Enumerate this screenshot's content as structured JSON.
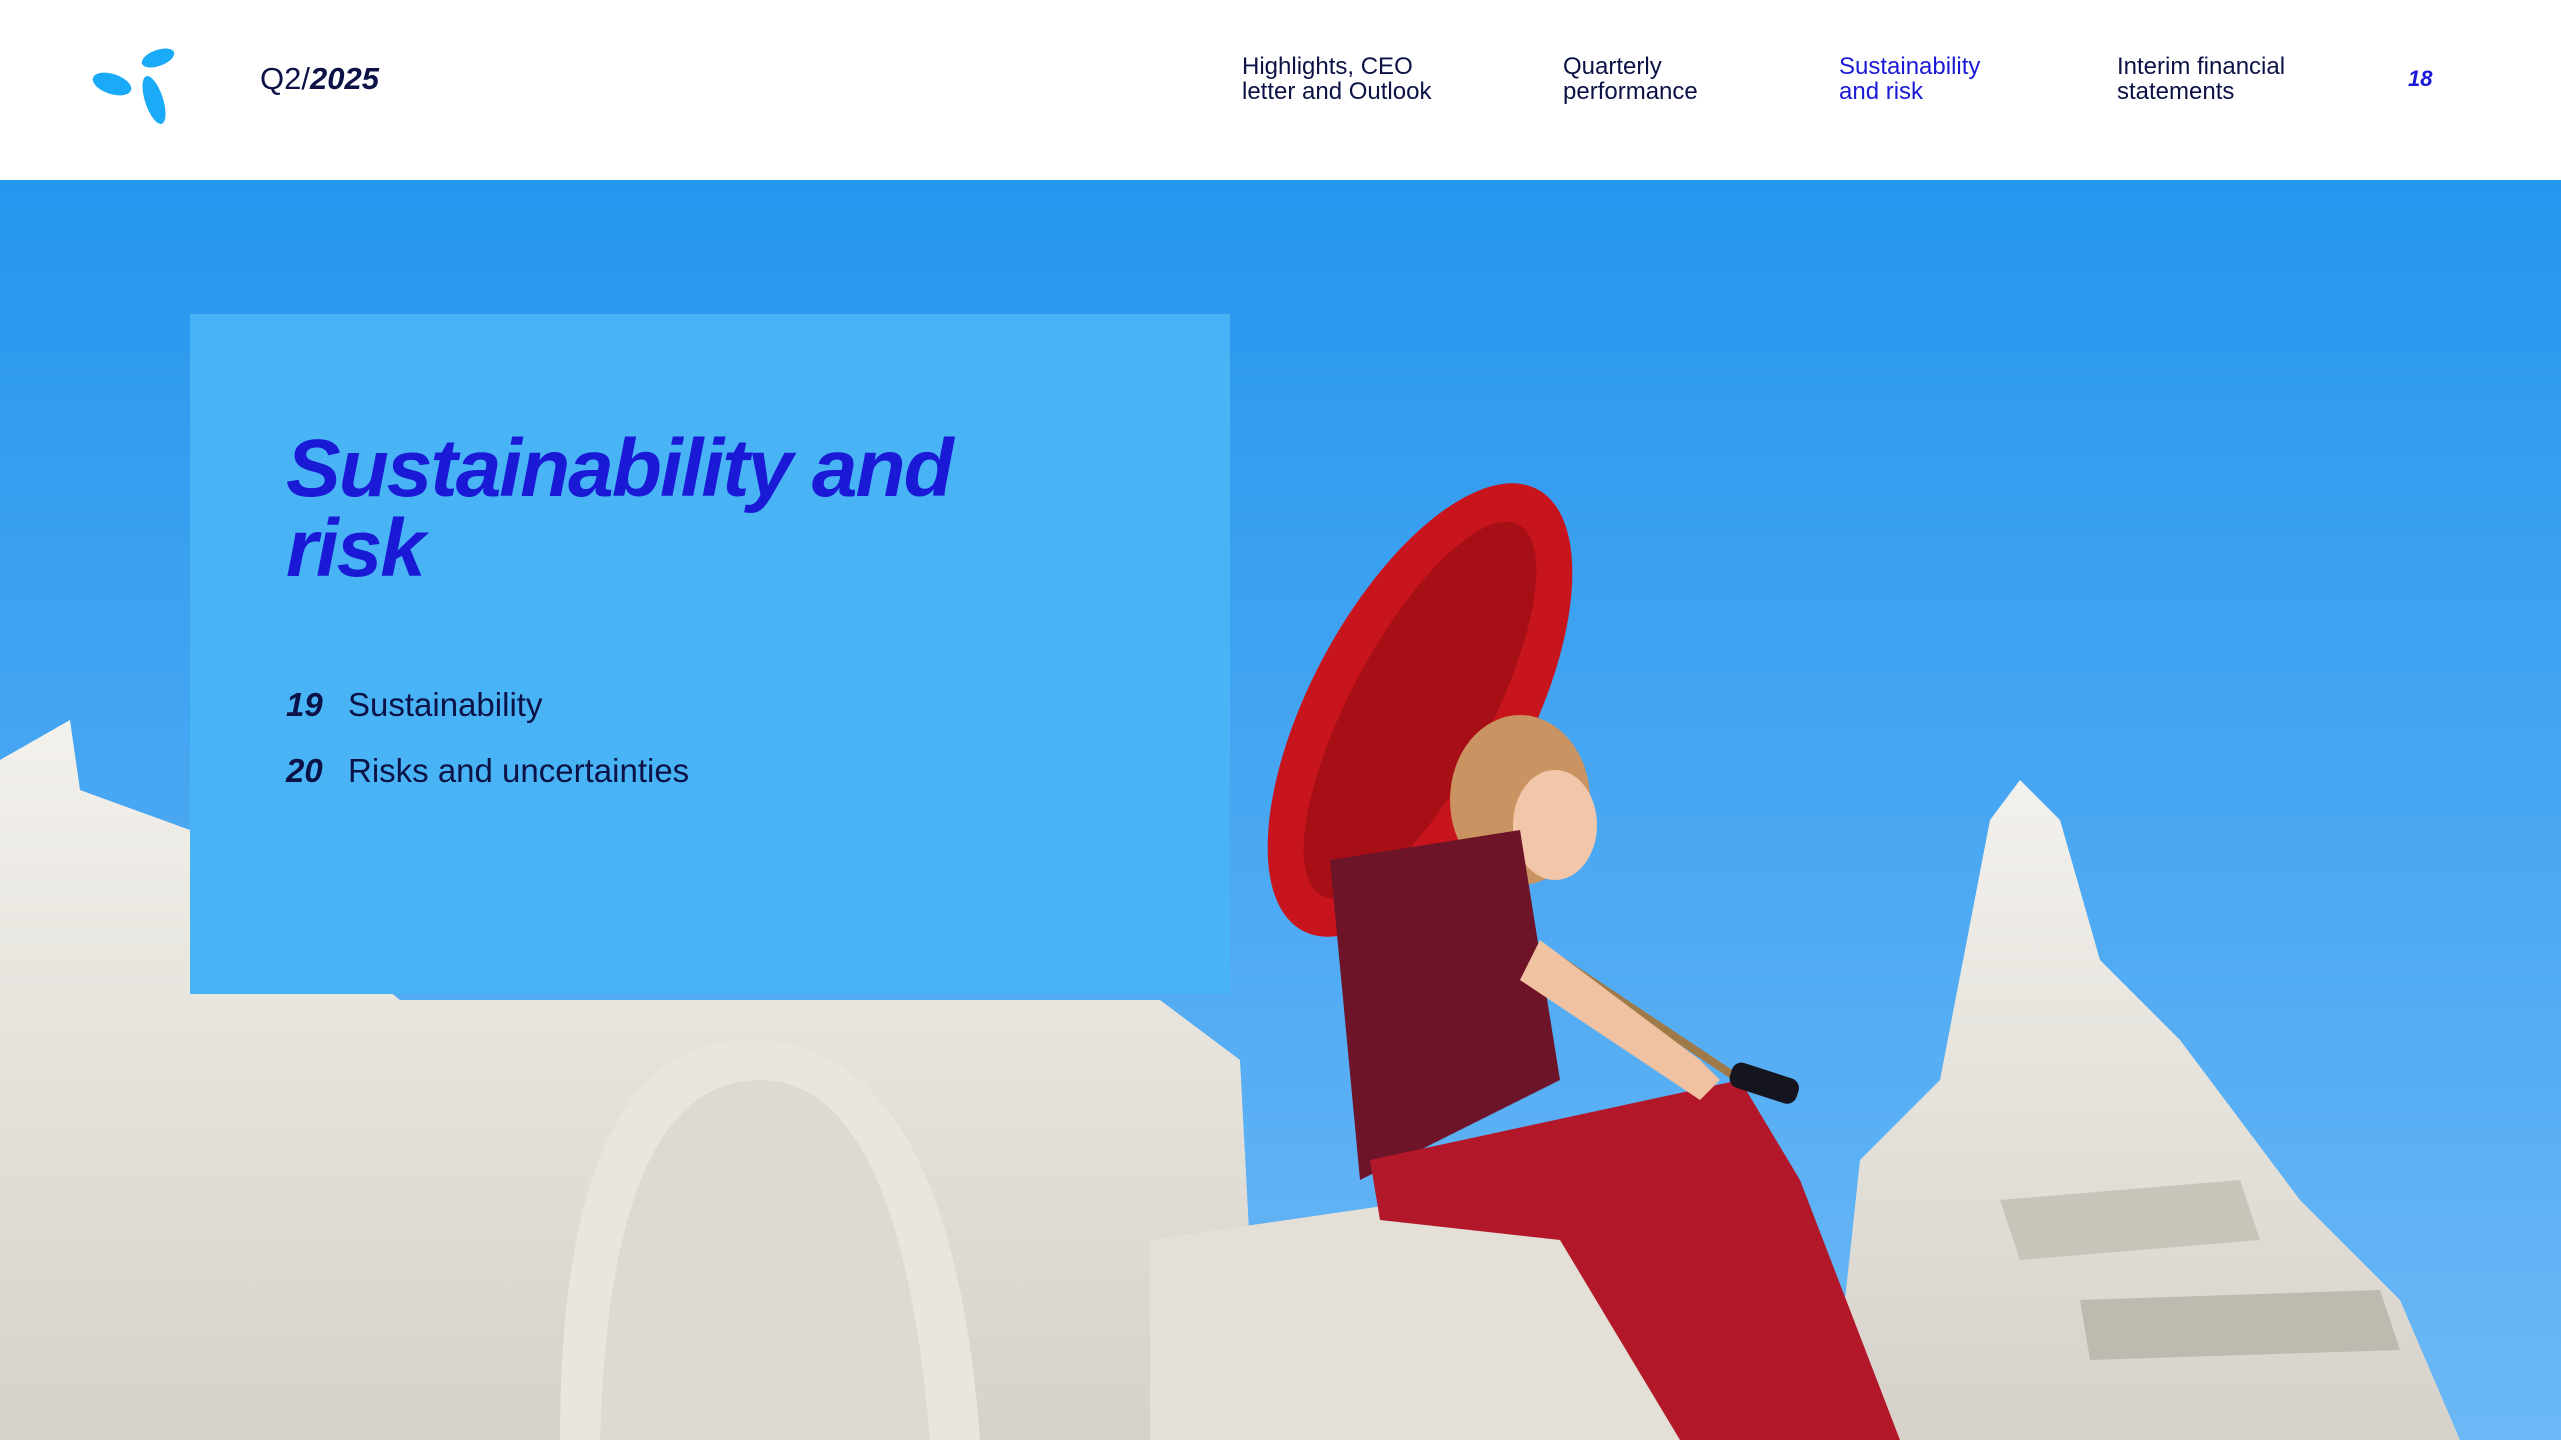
{
  "header": {
    "logo_icon": "telenor-propeller-icon",
    "quarter_prefix": "Q2/",
    "quarter_year": "2025",
    "nav": [
      {
        "line1": "Highlights, CEO",
        "line2": "letter and Outlook",
        "active": false
      },
      {
        "line1": "Quarterly",
        "line2": "performance",
        "active": false
      },
      {
        "line1": "Sustainability",
        "line2": "and risk",
        "active": true
      },
      {
        "line1": "Interim financial",
        "line2": "statements",
        "active": false
      }
    ],
    "page_number": "18"
  },
  "section": {
    "title_line1": "Sustainability and",
    "title_line2": "risk",
    "toc": [
      {
        "page": "19",
        "label": "Sustainability"
      },
      {
        "page": "20",
        "label": "Risks and uncertainties"
      }
    ]
  },
  "colors": {
    "brand_blue": "#1a1ad6",
    "box_blue": "#48b4f5",
    "sky_blue": "#2f9cf0",
    "navy_text": "#0c1246",
    "logo_cyan": "#19aaf8"
  }
}
